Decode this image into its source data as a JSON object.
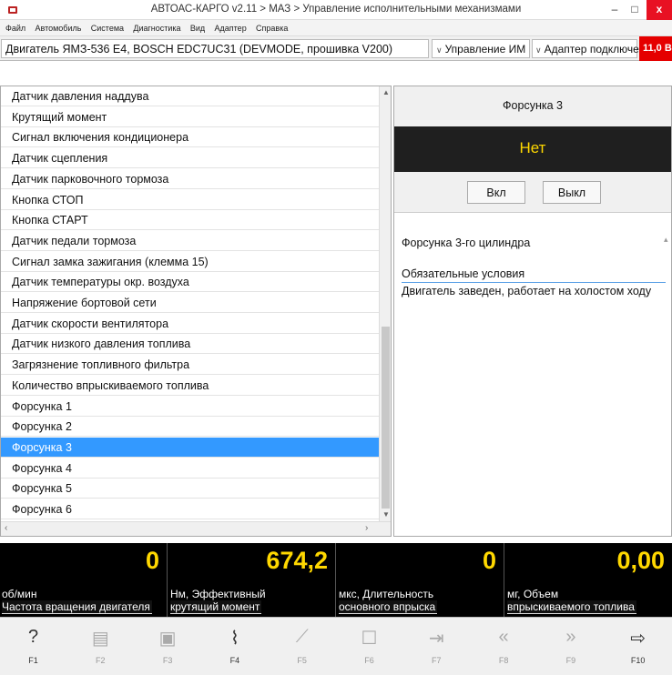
{
  "window": {
    "title": "АВТОАС-КАРГО v2.11 > МАЗ > Управление исполнительными механизмами",
    "min_glyph": "–",
    "max_glyph": "□",
    "close_glyph": "x"
  },
  "menu": [
    "Файл",
    "Автомобиль",
    "Система",
    "Диагностика",
    "Вид",
    "Адаптер",
    "Справка"
  ],
  "toolbar": {
    "engine": "Двигатель ЯМЗ-536 Е4, BOSCH EDC7UC31 (DEVMODE, прошивка V200)",
    "mode": "Управление ИМ",
    "adapter": "Адаптер подключен",
    "voltage": "11,0 В"
  },
  "list": {
    "items": [
      "Датчик давления наддува",
      "Крутящий момент",
      "Сигнал включения кондиционера",
      "Датчик сцепления",
      "Датчик парковочного тормоза",
      "Кнопка СТОП",
      "Кнопка СТАРТ",
      "Датчик педали тормоза",
      "Сигнал замка зажигания (клемма 15)",
      "Датчик температуры окр. воздуха",
      "Напряжение бортовой сети",
      "Датчик скорости вентилятора",
      "Датчик низкого давления топлива",
      "Загрязнение топливного фильтра",
      "Количество впрыскиваемого топлива",
      "Форсунка 1",
      "Форсунка 2",
      "Форсунка 3",
      "Форсунка 4",
      "Форсунка 5",
      "Форсунка 6"
    ],
    "selected_index": 17
  },
  "detail": {
    "header": "Форсунка 3",
    "state": "Нет",
    "btn_on": "Вкл",
    "btn_off": "Выкл",
    "description": "Форсунка 3-го цилиндра",
    "conditions_title": "Обязательные условия",
    "conditions_text": "Двигатель заведен, работает на холостом ходу"
  },
  "gauges": [
    {
      "value": "0",
      "unit": "об/мин",
      "param": "Частота вращения двигателя"
    },
    {
      "value": "674,2",
      "unit": "Нм, Эффективный",
      "param": "крутящий момент"
    },
    {
      "value": "0",
      "unit": "мкс, Длительность",
      "param": "основного впрыска"
    },
    {
      "value": "0,00",
      "unit": "мг, Объем",
      "param": "впрыскиваемого топлива"
    }
  ],
  "fkeys": [
    {
      "label": "F1",
      "icon": "help-icon",
      "glyph": "?",
      "enabled": true
    },
    {
      "label": "F2",
      "icon": "document-icon",
      "glyph": "▤",
      "enabled": false
    },
    {
      "label": "F3",
      "icon": "save-icon",
      "glyph": "▣",
      "enabled": false
    },
    {
      "label": "F4",
      "icon": "chart-icon",
      "glyph": "⌇",
      "enabled": true
    },
    {
      "label": "F5",
      "icon": "brush-icon",
      "glyph": "⟋",
      "enabled": false
    },
    {
      "label": "F6",
      "icon": "window-icon",
      "glyph": "☐",
      "enabled": false
    },
    {
      "label": "F7",
      "icon": "import-icon",
      "glyph": "⇥",
      "enabled": false
    },
    {
      "label": "F8",
      "icon": "rewind-icon",
      "glyph": "«",
      "enabled": false
    },
    {
      "label": "F9",
      "icon": "forward-icon",
      "glyph": "»",
      "enabled": false
    },
    {
      "label": "F10",
      "icon": "exit-icon",
      "glyph": "⇨",
      "enabled": true
    }
  ]
}
